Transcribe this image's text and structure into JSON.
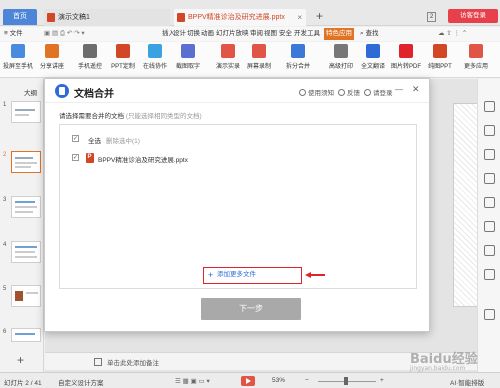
{
  "tabs": {
    "home": "首页",
    "doc1": "演示文稿1",
    "ppt": "BPPV精准诊治及研究进展.pptx",
    "window_count": "2",
    "visitor": "访客登录"
  },
  "menu": {
    "file": "≡ 文件",
    "items": [
      "插入",
      "设计",
      "切换",
      "动画",
      "幻灯片放映",
      "审阅",
      "视图",
      "安全",
      "开发工具",
      "特色应用"
    ],
    "active": "特色应用",
    "search": "查找"
  },
  "ribbon": {
    "buttons": [
      "投屏至手机",
      "分享讲座",
      "手机遥控",
      "PPT定制",
      "在线协作",
      "截图取字",
      "演示实录",
      "屏幕录制",
      "拆分合并",
      "高级打印",
      "全文翻译",
      "图片转PDF",
      "纯图PPT",
      "更多应用"
    ]
  },
  "left_panel": {
    "tab_outline": "大纲",
    "slide_numbers": [
      "1",
      "2",
      "3",
      "4",
      "5",
      "6"
    ]
  },
  "dialog": {
    "title": "文档合并",
    "help": "使用须知",
    "feedback": "反馈",
    "login": "请登录",
    "instruction": "请选择需要合并的文档",
    "instruction_hint": "(只能选择相同类型的文档)",
    "select_all": "全选",
    "delete_selected": "删除选中(1)",
    "file_name": "BPPV精准诊治及研究进展.pptx",
    "add_more": "添加更多文件",
    "next": "下一步"
  },
  "notes": {
    "placeholder": "单击此处添加备注"
  },
  "status": {
    "slide_position": "幻灯片 2 / 41",
    "theme": "自定义设计方案",
    "zoom": "53%",
    "assistant": "AI·智能排版"
  },
  "watermark": {
    "brand": "Baidu经验",
    "url": "jingyan.baidu.com"
  },
  "colors": {
    "accent_orange": "#e07324",
    "highlight_red": "#e0222a",
    "link_blue": "#2d6cd5"
  }
}
